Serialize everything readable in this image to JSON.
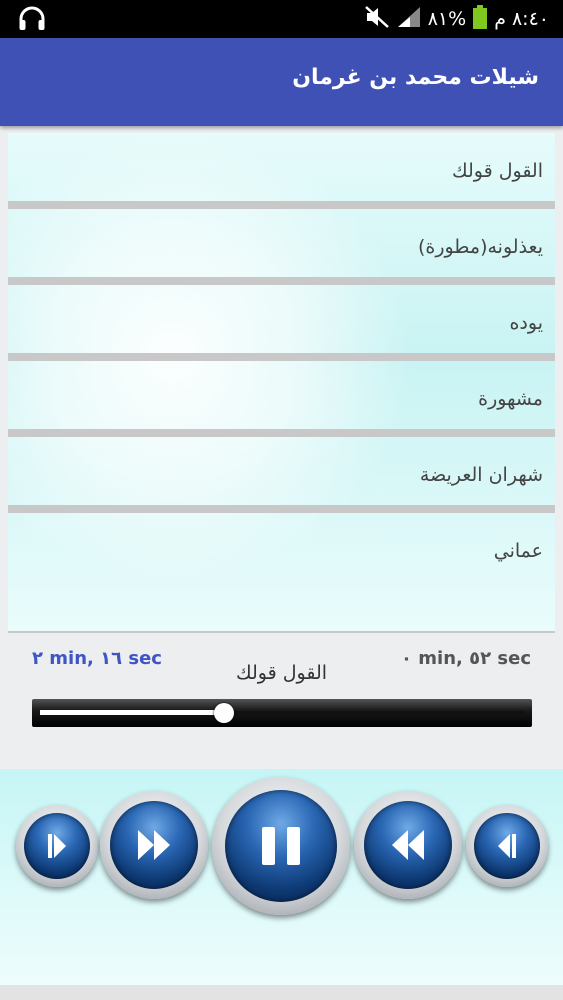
{
  "status_bar": {
    "time": "٨:٤٠",
    "ampm": "م",
    "battery": "٨١%"
  },
  "app": {
    "title": "شيلات محمد بن غرمان"
  },
  "playlist": [
    {
      "title": "القول قولك"
    },
    {
      "title": "يعذلونه(مطورة)"
    },
    {
      "title": "يوده"
    },
    {
      "title": "مشهورة"
    },
    {
      "title": "شهران العريضة"
    },
    {
      "title": "عماني"
    }
  ],
  "player": {
    "total_time": "٢ min, ١٦ sec",
    "current_time": "٠ min, ٥٢ sec",
    "now_playing": "القول قولك",
    "progress": 0.38
  },
  "controls": {
    "buttons": [
      "previous-track-icon",
      "rewind-icon",
      "pause-icon",
      "fast-forward-icon",
      "next-track-icon"
    ]
  },
  "colors": {
    "app_bar": "#3f51b5",
    "accent_time": "#3f55c4"
  }
}
